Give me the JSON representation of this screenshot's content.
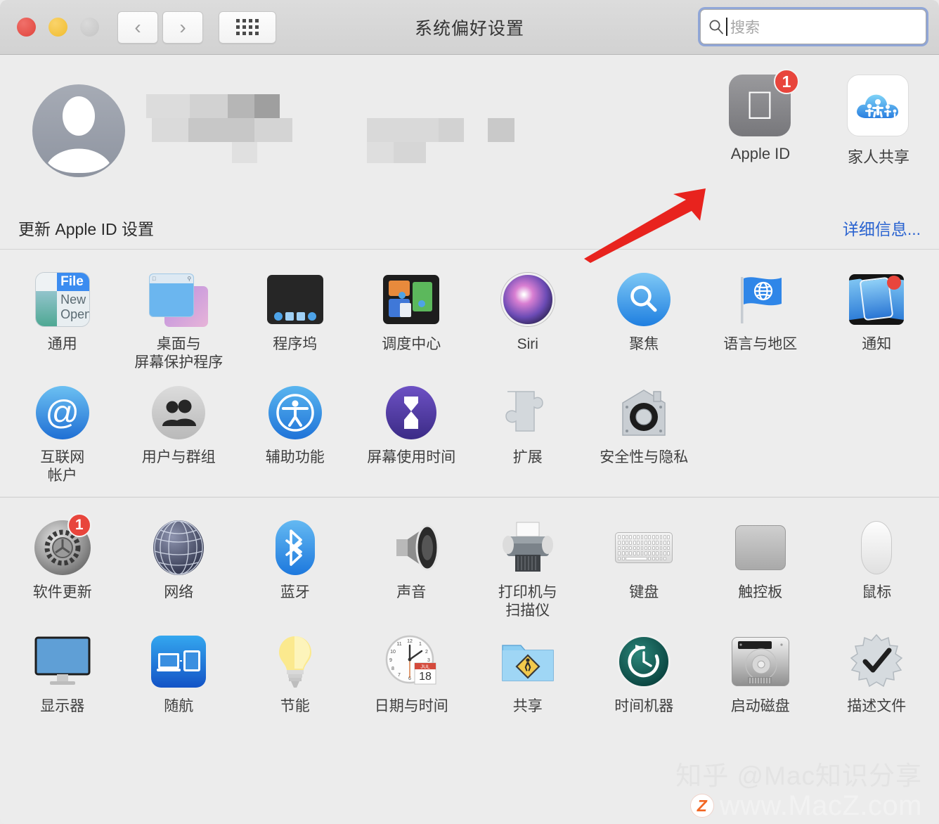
{
  "window": {
    "title": "系统偏好设置",
    "traffic_lights": [
      "close-button",
      "minimize-button",
      "zoom-button"
    ],
    "nav": {
      "back": "‹",
      "forward": "›",
      "grid": "grid-icon"
    }
  },
  "search": {
    "placeholder": "搜索",
    "value": "",
    "icon": "search-icon",
    "focused": true
  },
  "account": {
    "avatar": "user-avatar-placeholder",
    "name_redacted": true,
    "tiles": [
      {
        "label": "Apple ID",
        "icon": "apple-logo-icon",
        "badge": "1"
      },
      {
        "label": "家人共享",
        "icon": "family-sharing-cloud-icon",
        "badge": ""
      }
    ]
  },
  "update_banner": {
    "text": "更新 Apple ID 设置",
    "link": "详细信息..."
  },
  "sections": [
    {
      "id": "personal",
      "items": [
        {
          "label": "通用",
          "icon": "general-icon",
          "badge": ""
        },
        {
          "label": "桌面与\n屏幕保护程序",
          "icon": "desktop-screensaver-icon",
          "badge": ""
        },
        {
          "label": "程序坞",
          "icon": "dock-icon",
          "badge": ""
        },
        {
          "label": "调度中心",
          "icon": "mission-control-icon",
          "badge": ""
        },
        {
          "label": "Siri",
          "icon": "siri-icon",
          "badge": ""
        },
        {
          "label": "聚焦",
          "icon": "spotlight-icon",
          "badge": ""
        },
        {
          "label": "语言与地区",
          "icon": "language-region-flag-icon",
          "badge": ""
        },
        {
          "label": "通知",
          "icon": "notifications-icon",
          "badge": ""
        },
        {
          "label": "互联网\n帐户",
          "icon": "internet-accounts-icon",
          "badge": ""
        },
        {
          "label": "用户与群组",
          "icon": "users-groups-icon",
          "badge": ""
        },
        {
          "label": "辅助功能",
          "icon": "accessibility-icon",
          "badge": ""
        },
        {
          "label": "屏幕使用时间",
          "icon": "screen-time-icon",
          "badge": ""
        },
        {
          "label": "扩展",
          "icon": "extensions-puzzle-icon",
          "badge": ""
        },
        {
          "label": "安全性与隐私",
          "icon": "security-privacy-icon",
          "badge": ""
        }
      ]
    },
    {
      "id": "hardware",
      "items": [
        {
          "label": "软件更新",
          "icon": "software-update-gear-icon",
          "badge": "1"
        },
        {
          "label": "网络",
          "icon": "network-globe-icon",
          "badge": ""
        },
        {
          "label": "蓝牙",
          "icon": "bluetooth-icon",
          "badge": ""
        },
        {
          "label": "声音",
          "icon": "sound-speaker-icon",
          "badge": ""
        },
        {
          "label": "打印机与\n扫描仪",
          "icon": "printers-scanners-icon",
          "badge": ""
        },
        {
          "label": "键盘",
          "icon": "keyboard-icon",
          "badge": ""
        },
        {
          "label": "触控板",
          "icon": "trackpad-icon",
          "badge": ""
        },
        {
          "label": "鼠标",
          "icon": "mouse-icon",
          "badge": ""
        },
        {
          "label": "显示器",
          "icon": "displays-icon",
          "badge": ""
        },
        {
          "label": "随航",
          "icon": "sidecar-icon",
          "badge": ""
        },
        {
          "label": "节能",
          "icon": "energy-saver-bulb-icon",
          "badge": ""
        },
        {
          "label": "日期与时间",
          "icon": "date-time-clock-icon",
          "badge": ""
        },
        {
          "label": "共享",
          "icon": "sharing-folder-icon",
          "badge": ""
        },
        {
          "label": "时间机器",
          "icon": "time-machine-icon",
          "badge": ""
        },
        {
          "label": "启动磁盘",
          "icon": "startup-disk-icon",
          "badge": ""
        },
        {
          "label": "描述文件",
          "icon": "profiles-check-icon",
          "badge": ""
        }
      ]
    }
  ],
  "general_icon_text": {
    "menu": "File",
    "line1": "New",
    "line2": "Open"
  },
  "date_icon": {
    "month": "JUL",
    "day": "18"
  },
  "annotation": {
    "type": "arrow",
    "color": "#e8231e",
    "points_to": "Apple ID"
  },
  "watermark": {
    "line1": "知乎 @Mac知识分享",
    "badge": "Z",
    "url": "www.MacZ.com"
  },
  "colors": {
    "window_bg": "#ececec",
    "titlebar": "#d6d6d6",
    "accent_link": "#2a63d0",
    "badge_red": "#e8453c",
    "annotation_red": "#e8231e"
  }
}
